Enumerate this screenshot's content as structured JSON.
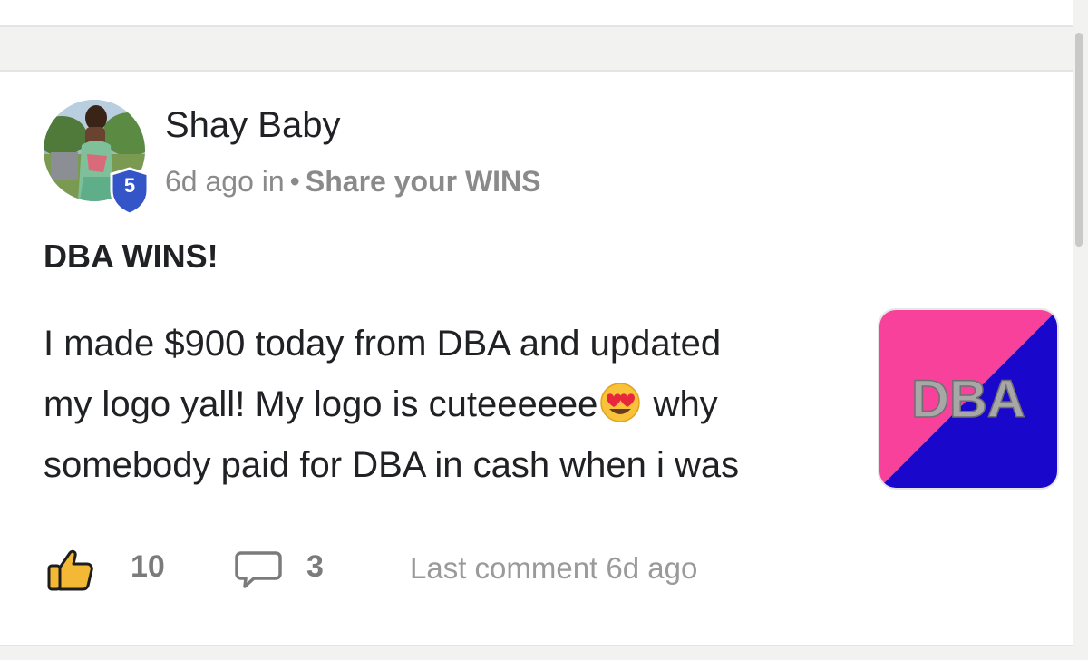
{
  "post": {
    "author": {
      "name": "Shay Baby",
      "level": "5",
      "avatar_icon": "profile-photo"
    },
    "meta": {
      "time": "6d ago in",
      "separator": "•",
      "category": "Share your WINS"
    },
    "title": "DBA WINS!",
    "body": {
      "line1": "I made $900 today from DBA and updated",
      "line2_before": "my logo yall! My logo is cuteeeeee",
      "line2_emoji": "heart-eyes-emoji",
      "line2_after": " why",
      "line3": "somebody paid for DBA in cash when i was"
    },
    "thumbnail": {
      "logo_text": "DBA",
      "color_left": "#f7419b",
      "color_right": "#1a07cc"
    },
    "stats": {
      "like_icon": "thumbs-up-icon",
      "likes": "10",
      "comment_icon": "comment-bubble-icon",
      "comments": "3",
      "last_comment": "Last comment 6d ago"
    }
  },
  "colors": {
    "level_badge": "#3355c8",
    "text_primary": "#202124",
    "text_muted": "#8a8a8a"
  }
}
